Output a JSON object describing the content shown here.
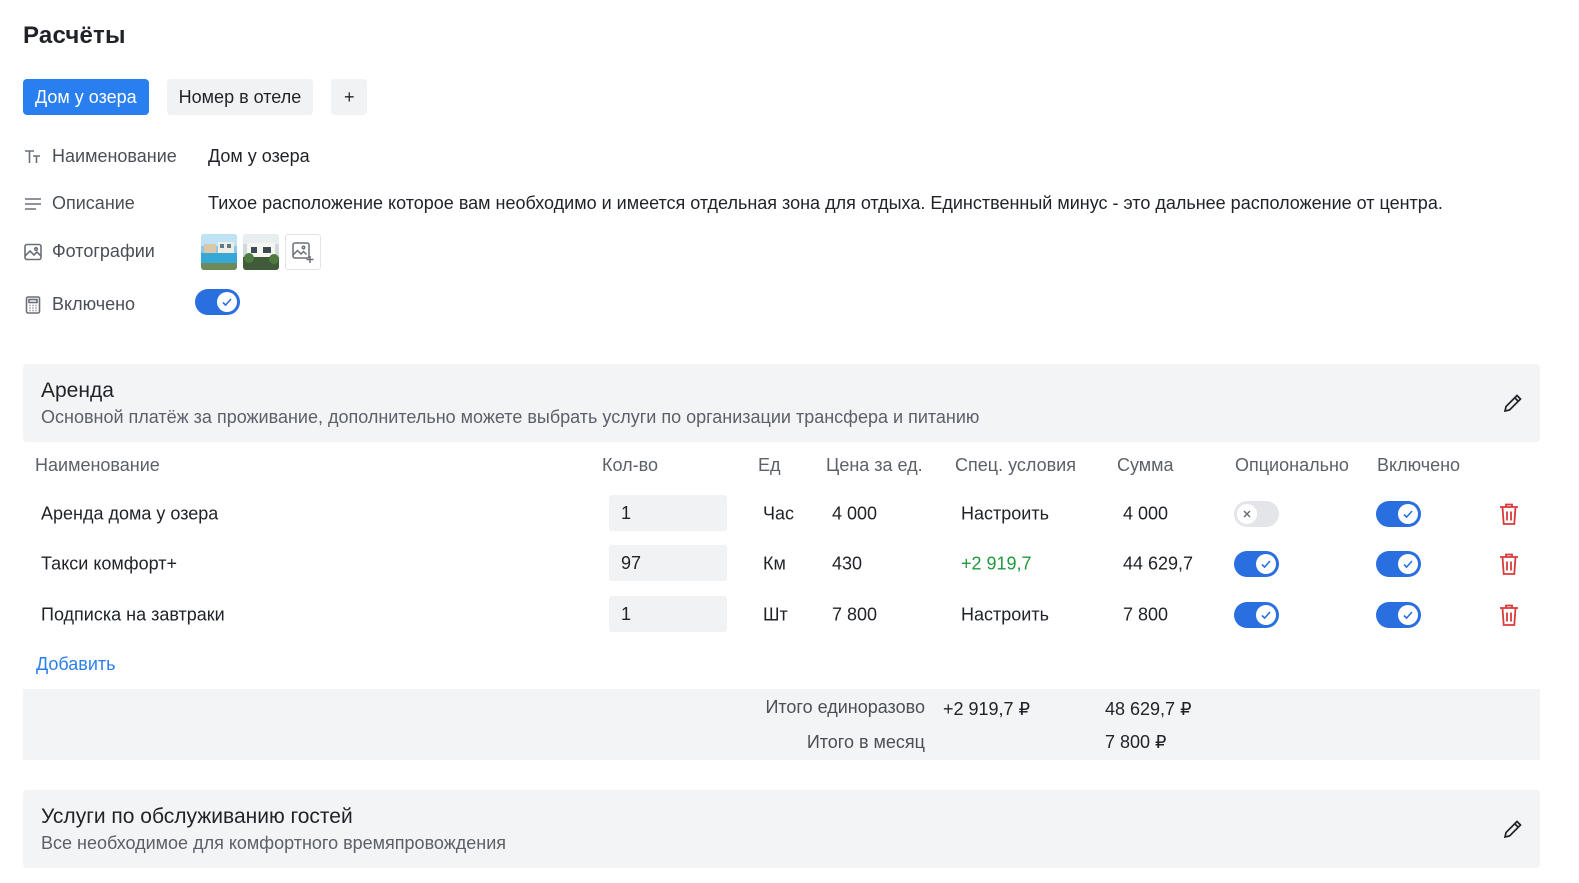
{
  "page": {
    "title": "Расчёты"
  },
  "tabs": [
    {
      "label": "Дом у озера",
      "active": true
    },
    {
      "label": "Номер в отеле",
      "active": false
    },
    {
      "label": "+",
      "active": false
    }
  ],
  "properties": {
    "name": {
      "label": "Наименование",
      "value": "Дом у озера",
      "icon": "text-type-icon"
    },
    "description": {
      "label": "Описание",
      "value": "Тихое расположение которое вам необходимо и имеется отдельная зона для отдыха.  Единственный минус - это дальнее расположение от центра.",
      "icon": "lines-icon"
    },
    "photos": {
      "label": "Фотографии",
      "icon": "image-icon",
      "count": 2
    },
    "enabled": {
      "label": "Включено",
      "icon": "calculator-icon",
      "value": true
    }
  },
  "rent_section": {
    "title": "Аренда",
    "description": "Основной платёж за проживание, дополнительно можете выбрать услуги по организации трансфера и питанию",
    "columns": [
      "Наименование",
      "Кол-во",
      "Ед",
      "Цена за ед.",
      "Спец. условия",
      "Сумма",
      "Опционально",
      "Включено"
    ],
    "rows": [
      {
        "name": "Аренда дома у озера",
        "qty": "1",
        "unit": "Час",
        "price": "4 000",
        "special": "Настроить",
        "special_highlight": false,
        "sum": "4 000",
        "optional": false,
        "enabled": true
      },
      {
        "name": "Такси комфорт+",
        "qty": "97",
        "unit": "Км",
        "price": "430",
        "special": "+2 919,7",
        "special_highlight": true,
        "sum": "44 629,7",
        "optional": true,
        "enabled": true
      },
      {
        "name": "Подписка на завтраки",
        "qty": "1",
        "unit": "Шт",
        "price": "7 800",
        "special": "Настроить",
        "special_highlight": false,
        "sum": "7 800",
        "optional": true,
        "enabled": true
      }
    ],
    "add_label": "Добавить",
    "totals": {
      "once_label": "Итого единоразово",
      "once_special": "+2 919,7 ₽",
      "once_value": "48 629,7 ₽",
      "monthly_label": "Итого в месяц",
      "monthly_value": "7 800 ₽"
    }
  },
  "guest_section": {
    "title": "Услуги по обслуживанию гостей",
    "description": "Все необходимое для комфортного времяпровождения"
  },
  "colors": {
    "accent": "#2a7ff0",
    "toggle_on": "#2a6fe0",
    "positive": "#1e9a3c",
    "danger": "#d93a3a",
    "panel": "#f3f4f6"
  }
}
